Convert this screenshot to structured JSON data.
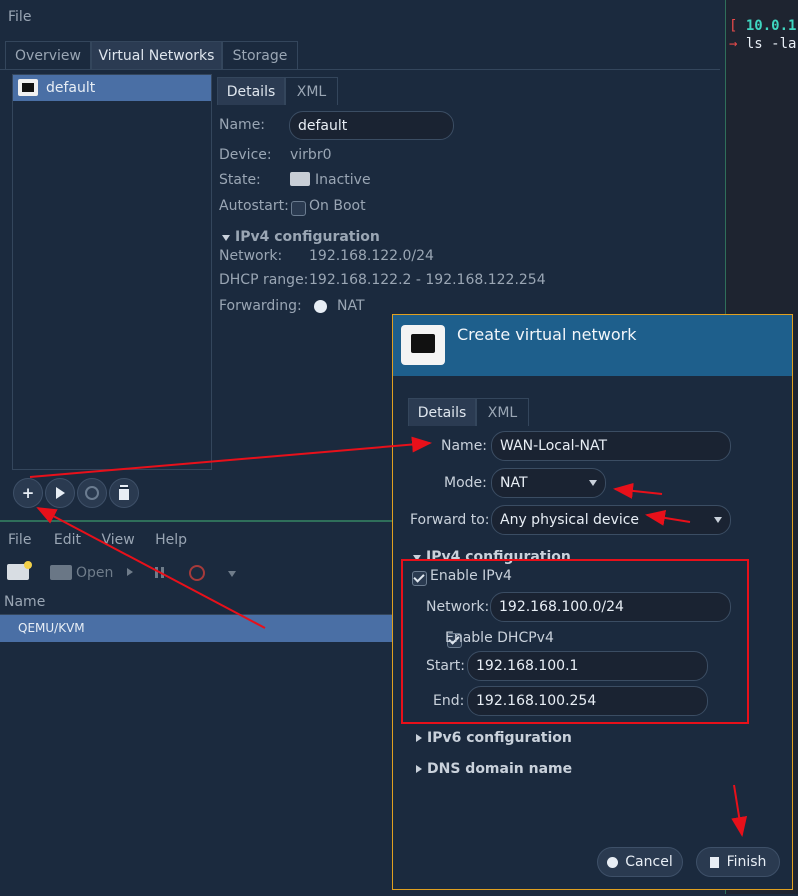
{
  "top_window": {
    "menu_file": "File",
    "tabs": [
      "Overview",
      "Virtual Networks",
      "Storage"
    ],
    "network_list": [
      "default"
    ],
    "detail_tabs": [
      "Details",
      "XML"
    ],
    "labels": {
      "name": "Name:",
      "device": "Device:",
      "state": "State:",
      "autostart": "Autostart:",
      "ipv4": "IPv4 configuration",
      "network": "Network:",
      "dhcp": "DHCP range:",
      "forwarding": "Forwarding:"
    },
    "values": {
      "name": "default",
      "device": "virbr0",
      "state": "Inactive",
      "autostart": "On Boot",
      "network": "192.168.122.0/24",
      "dhcp": "192.168.122.2 - 192.168.122.254",
      "forwarding": "NAT"
    }
  },
  "terminal": {
    "line1_bracket": "[",
    "line1_text": "10.0.1",
    "line2_arrow": "→",
    "line2_text": "ls -la"
  },
  "bottom_window": {
    "menu": [
      "File",
      "Edit",
      "View",
      "Help"
    ],
    "toolbar_open": "Open",
    "column_name": "Name",
    "row": "QEMU/KVM"
  },
  "dialog": {
    "title": "Create virtual network",
    "tabs": [
      "Details",
      "XML"
    ],
    "labels": {
      "name": "Name:",
      "mode": "Mode:",
      "forward_to": "Forward to:",
      "ipv4": "IPv4 configuration",
      "enable_ipv4": "Enable IPv4",
      "network": "Network:",
      "enable_dhcp": "Enable DHCPv4",
      "start": "Start:",
      "end": "End:",
      "ipv6": "IPv6 configuration",
      "dns": "DNS domain name"
    },
    "values": {
      "name": "WAN-Local-NAT",
      "mode": "NAT",
      "forward_to": "Any physical device",
      "network": "192.168.100.0/24",
      "start": "192.168.100.1",
      "end": "192.168.100.254"
    },
    "buttons": {
      "cancel": "Cancel",
      "finish": "Finish"
    }
  },
  "colors": {
    "dialog_header": "#1e5f8c",
    "selection": "#4a6fa5",
    "annotation": "#e8101a",
    "dialog_border": "#e0a020"
  }
}
